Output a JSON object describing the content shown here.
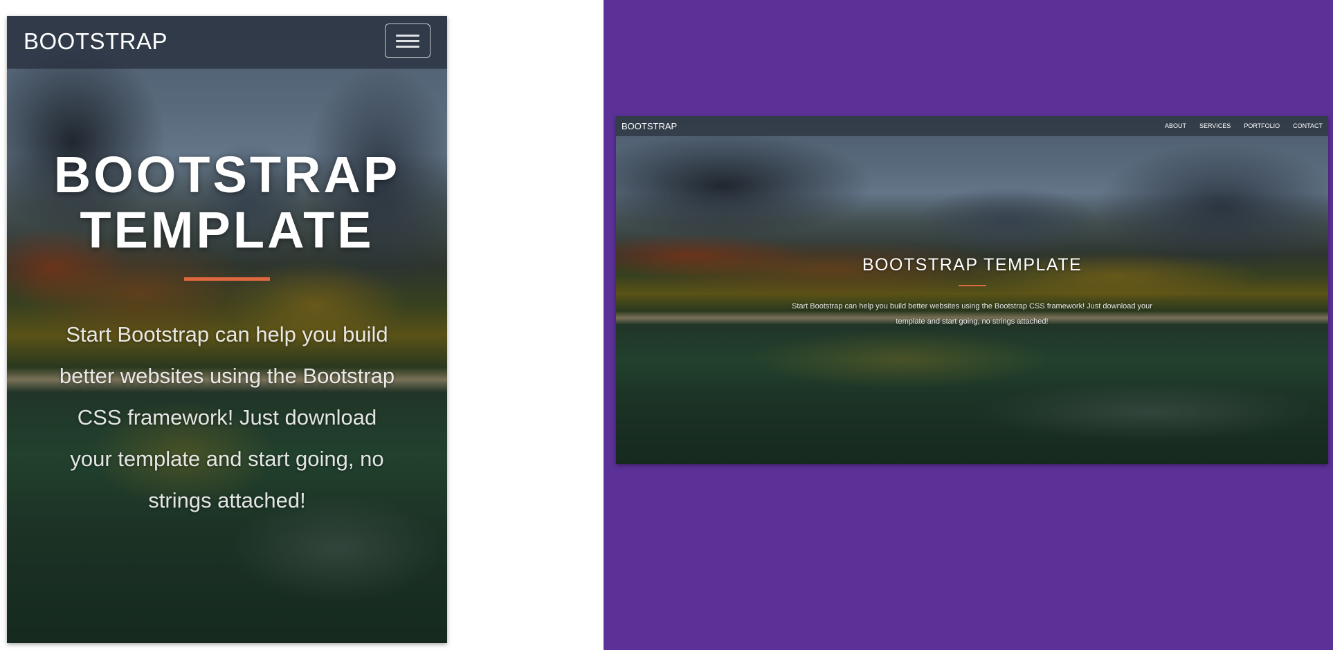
{
  "colors": {
    "background_panel": "#5c3197",
    "accent_divider": "#e0683f",
    "text": "#ffffff"
  },
  "mobile": {
    "brand": "BOOTSTRAP",
    "menu_icon": "hamburger-menu-icon",
    "title": "BOOTSTRAP TEMPLATE",
    "subtitle": "Start Bootstrap can help you build better websites using the Bootstrap CSS framework! Just download your template and start going, no strings attached!"
  },
  "desktop": {
    "brand": "BOOTSTRAP",
    "nav": [
      "ABOUT",
      "SERVICES",
      "PORTFOLIO",
      "CONTACT"
    ],
    "title": "BOOTSTRAP TEMPLATE",
    "subtitle": "Start Bootstrap can help you build better websites using the Bootstrap CSS framework! Just download your template and start going, no strings attached!"
  }
}
